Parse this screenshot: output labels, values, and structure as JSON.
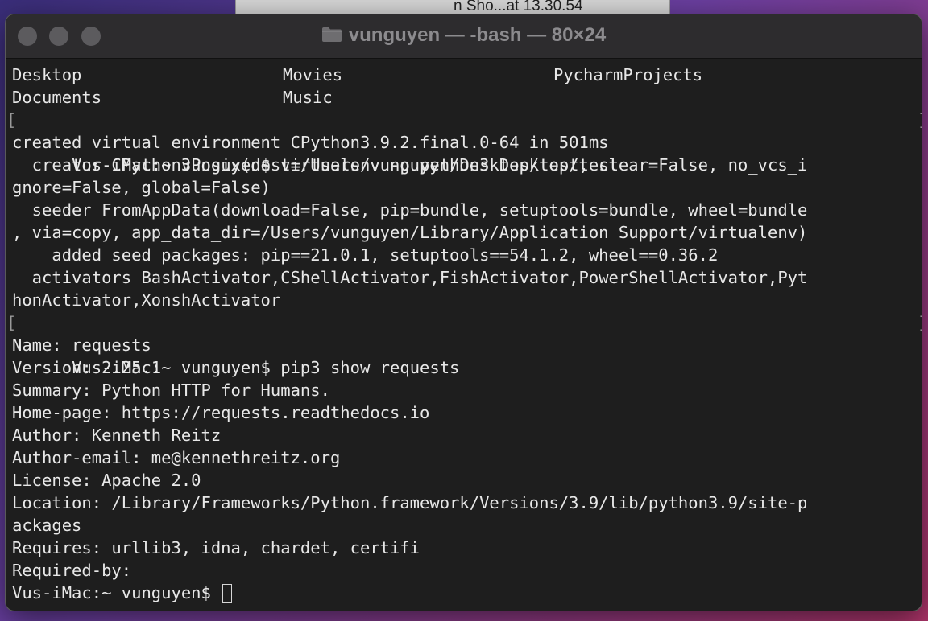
{
  "background_window": {
    "title": "n Sho...at 13.30.54"
  },
  "window": {
    "title": "vunguyen — -bash — 80×24",
    "folder_icon": "folder-icon"
  },
  "terminal": {
    "listing": [
      [
        "Desktop",
        "Movies",
        "PycharmProjects"
      ],
      [
        "Documents",
        "Music",
        ""
      ]
    ],
    "prompt_1": "Vus-iMac:~ vunguyen$ virtualenv -p python3 Desktop/test",
    "output_1": [
      "created virtual environment CPython3.9.2.final.0-64 in 501ms",
      "  creator CPython3Posix(dest=/Users/vunguyen/Desktop/test, clear=False, no_vcs_i",
      "gnore=False, global=False)",
      "  seeder FromAppData(download=False, pip=bundle, setuptools=bundle, wheel=bundle",
      ", via=copy, app_data_dir=/Users/vunguyen/Library/Application Support/virtualenv)",
      "    added seed packages: pip==21.0.1, setuptools==54.1.2, wheel==0.36.2",
      "  activators BashActivator,CShellActivator,FishActivator,PowerShellActivator,Pyt",
      "honActivator,XonshActivator"
    ],
    "prompt_2": "Vus-iMac:~ vunguyen$ pip3 show requests",
    "output_2": [
      "Name: requests",
      "Version: 2.25.1",
      "Summary: Python HTTP for Humans.",
      "Home-page: https://requests.readthedocs.io",
      "Author: Kenneth Reitz",
      "Author-email: me@kennethreitz.org",
      "License: Apache 2.0",
      "Location: /Library/Frameworks/Python.framework/Versions/3.9/lib/python3.9/site-p",
      "ackages",
      "Requires: urllib3, idna, chardet, certifi",
      "Required-by:"
    ],
    "prompt_3": "Vus-iMac:~ vunguyen$ ",
    "bracket_left": "[",
    "bracket_right": "]"
  }
}
